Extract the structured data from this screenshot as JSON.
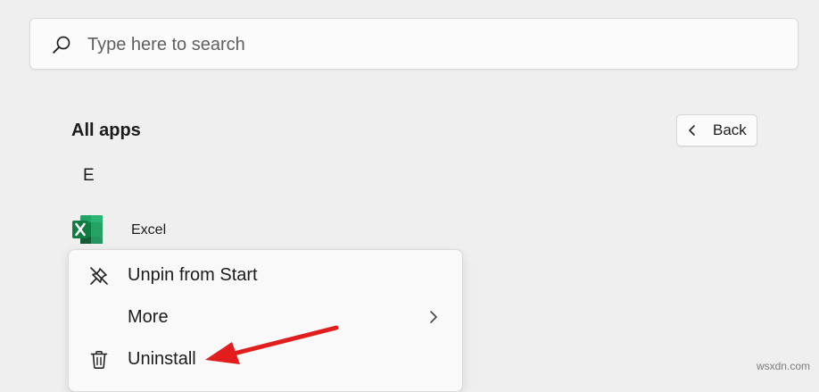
{
  "search": {
    "placeholder": "Type here to search"
  },
  "all_apps": {
    "title": "All apps",
    "back_label": "Back"
  },
  "apps_list": {
    "section_letter": "E",
    "items": [
      {
        "name": "Excel",
        "icon": "excel-icon",
        "icon_color": "#1f7a43"
      }
    ]
  },
  "context_menu": {
    "items": [
      {
        "label": "Unpin from Start",
        "icon": "unpin-icon"
      },
      {
        "label": "More",
        "icon": "chevron-right-icon"
      },
      {
        "label": "Uninstall",
        "icon": "trash-icon"
      }
    ]
  },
  "annotation": {
    "arrow_color": "#e11d1d"
  },
  "watermark": "wsxdn.com"
}
